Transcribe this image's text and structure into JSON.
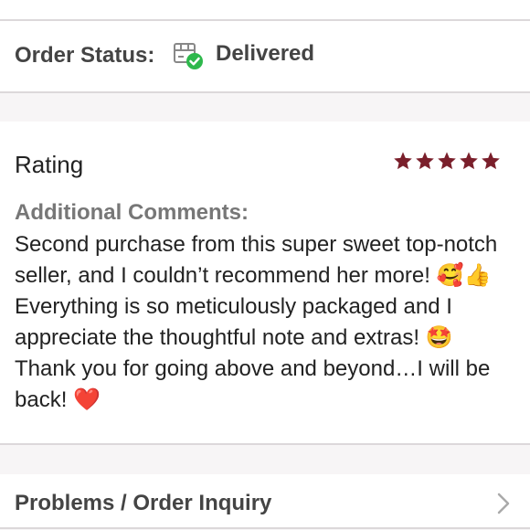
{
  "order_status": {
    "label": "Order Status:",
    "value": "Delivered",
    "icon": "package-delivered-icon",
    "check_color": "#2eb84c"
  },
  "rating": {
    "title": "Rating",
    "stars": 5,
    "star_color": "#7a1f2b",
    "comments_label": "Additional Comments:",
    "comment": "Second purchase from this super sweet top-notch seller, and I couldn’t recommend her more! 🥰👍 Everything is so meticulously packaged and I appreciate the thoughtful note and extras! 🤩 Thank you for going above and beyond…I will be back! ❤️"
  },
  "problems": {
    "label": "Problems / Order Inquiry"
  }
}
